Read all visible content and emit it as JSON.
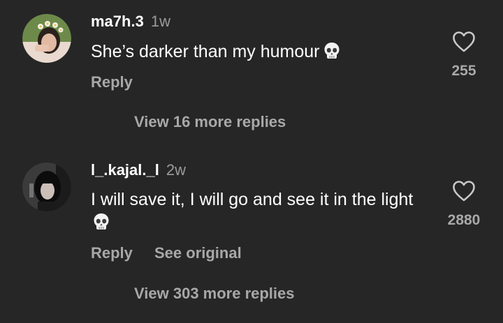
{
  "comments": [
    {
      "username": "ma7h.3",
      "time": "1w",
      "text": "She’s darker than my humour",
      "emoji": "skull-emoji",
      "reply_label": "Reply",
      "like_count": "255",
      "view_more": "View 16 more replies"
    },
    {
      "username": "l_.kajal._l",
      "time": "2w",
      "text": "I will save it, I will go and see it in the light",
      "emoji": "skull-emoji",
      "reply_label": "Reply",
      "see_original_label": "See original",
      "like_count": "2880",
      "view_more": "View 303 more replies"
    }
  ],
  "colors": {
    "background": "#262626",
    "primary_text": "#ffffff",
    "secondary_text": "#a8a8a8"
  },
  "icons": {
    "like": "heart-outline-icon"
  }
}
